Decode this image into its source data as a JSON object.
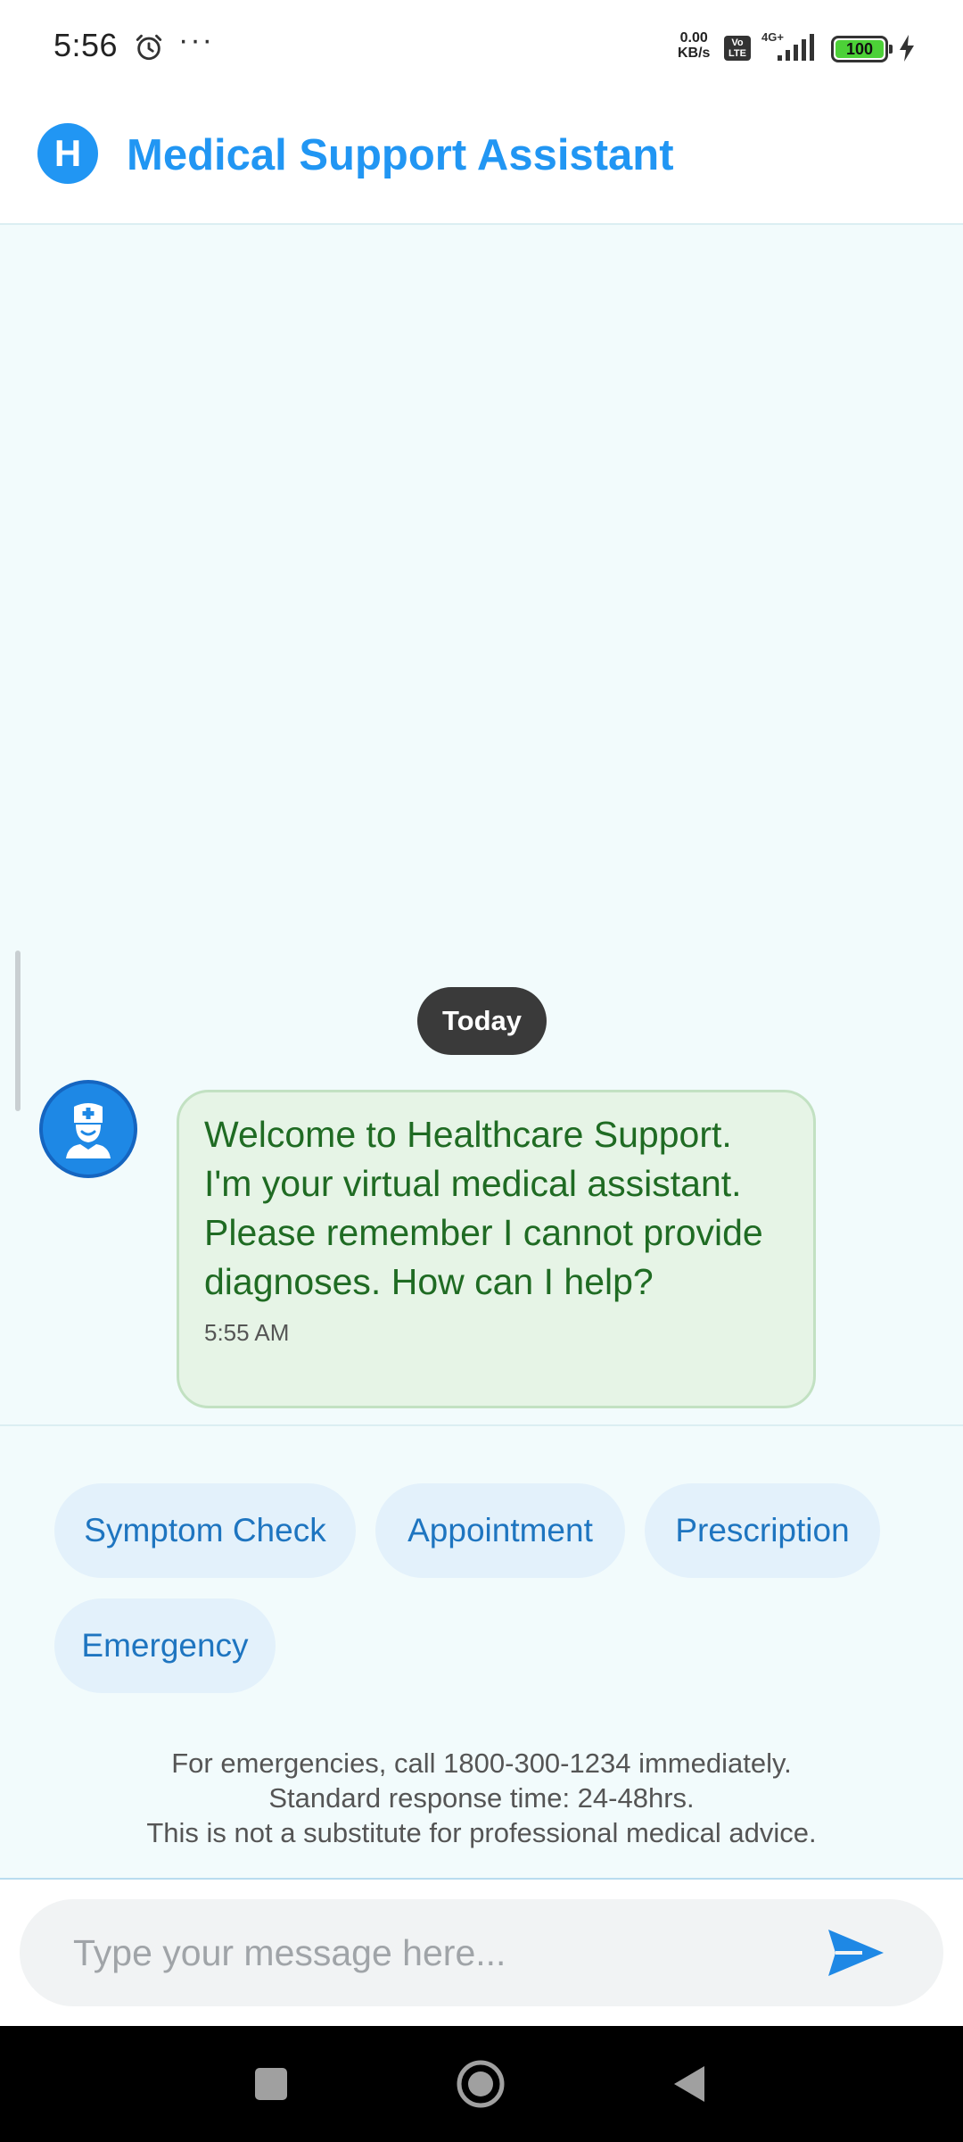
{
  "status_bar": {
    "time": "5:56",
    "more": "···",
    "speed_value": "0.00",
    "speed_unit": "KB/s",
    "volte_top": "Vo",
    "volte_bottom": "LTE",
    "network": "4G+",
    "battery": "100",
    "battery_color": "#4cd137"
  },
  "header": {
    "logo_letter": "H",
    "title": "Medical Support Assistant",
    "accent_color": "#2196f3"
  },
  "chat": {
    "date_chip": "Today",
    "messages": [
      {
        "sender_icon": "doctor-avatar-icon",
        "text": "Welcome to Healthcare Support. I'm your virtual medical assistant. Please remember I cannot provide diagnoses. How can I help?",
        "time": "5:55 AM"
      }
    ]
  },
  "quick_actions": [
    {
      "label": "Symptom Check"
    },
    {
      "label": "Appointment"
    },
    {
      "label": "Prescription"
    },
    {
      "label": "Emergency"
    }
  ],
  "disclaimer": {
    "line1": "For emergencies, call 1800-300-1234 immediately.",
    "line2": "Standard response time: 24-48hrs.",
    "line3": "This is not a substitute for professional medical advice."
  },
  "input": {
    "placeholder": "Type your message here...",
    "value": "",
    "send_icon": "send-icon"
  },
  "nav_bar": {
    "icons": [
      "recents-icon",
      "home-icon",
      "back-icon"
    ]
  }
}
